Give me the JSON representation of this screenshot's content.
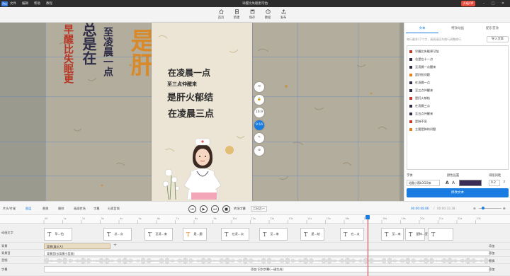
{
  "app": {
    "logo": "Pro",
    "menu": [
      "文件",
      "编辑",
      "帮助",
      "教程"
    ],
    "title": "早醒比失眠更可怕",
    "vip": "升级VIP",
    "colors": {
      "accent": "#1a7be0",
      "vip": "#e84b3c"
    }
  },
  "toolbar": [
    {
      "label": "首页",
      "icon": "home-icon"
    },
    {
      "label": "新建",
      "icon": "new-file-icon"
    },
    {
      "label": "保存",
      "icon": "save-icon"
    },
    {
      "label": "教程",
      "icon": "help-icon"
    },
    {
      "label": "发布",
      "icon": "export-icon"
    }
  ],
  "canvas": {
    "bg_left": [
      "早醒比失眠更",
      "总是在",
      "至凌晨一点",
      "是肝"
    ],
    "bg_right": [
      "是肝火郁结"
    ],
    "captions": [
      "在凌晨一点",
      "至三点仲醒来",
      "是肝火郁结",
      "在凌晨三点"
    ],
    "side_buttons": [
      "⟲",
      "🔒",
      "16:9",
      "9:16",
      "✎",
      "⊚"
    ]
  },
  "panel": {
    "tabs": [
      "文本",
      "特效动画",
      "配乐音效"
    ],
    "hint": "每行最多17个字，请直接回车换行调整换行",
    "import_label": "导入文本",
    "items": [
      {
        "text": "早醒比失眠更可怕",
        "color": "#c0392b"
      },
      {
        "text": "总是在十一点",
        "color": "#2c2c4a"
      },
      {
        "text": "至凌晨一点醒来",
        "color": "#2c2c4a"
      },
      {
        "text": "是肝胆问题",
        "color": "#e67e22"
      },
      {
        "text": "在凌晨一点",
        "color": "#2c2c4a"
      },
      {
        "text": "至三点仲醒来",
        "color": "#2c2c4a"
      },
      {
        "text": "是肝火郁结",
        "color": "#c0392b"
      },
      {
        "text": "在凌晨三点",
        "color": "#2c2c4a"
      },
      {
        "text": "至五点仲醒来",
        "color": "#2c2c4a"
      },
      {
        "text": "是肺不宣",
        "color": "#c0392b"
      },
      {
        "text": "主要是肺的问题",
        "color": "#e67e22"
      }
    ],
    "font_label": "字体",
    "font_value": "站酷小薇LOGO体",
    "color_label": "颜色设置",
    "size_label": "排版间距",
    "size_value": "0.2",
    "modify_label": "修改文本"
  },
  "timeline": {
    "left_tools": [
      "片头/片尾",
      "图层",
      "替换",
      "删除",
      "画面转场",
      "字幕",
      "分离音频"
    ],
    "ratio_label": "转场字幕",
    "ratio_value": "二分之一",
    "time_current": "00:00:08.86",
    "time_total": "00:00:33.38",
    "ruler": [
      "00",
      "1s",
      "2s",
      "3s",
      "4s",
      "5s",
      "6s",
      "7s",
      "8s",
      "9s",
      "10s",
      "11s",
      "12s",
      "13s",
      "14s",
      "15s",
      "16s",
      "17s",
      "18s",
      "19s",
      "20s",
      "21s",
      "22s",
      "23s"
    ],
    "playhead_fraction": 0.38,
    "tracks": [
      "动画文字",
      "背景",
      "背景音",
      "音频",
      "字幕"
    ],
    "clips": [
      "早...怕",
      "总...点",
      "至凌...来",
      "是...题",
      "在凌...点",
      "至...来",
      "是...结",
      "在...点",
      "至...来",
      "是肺...宣",
      ""
    ],
    "bg_clip": "背景(展示大)",
    "music_clip": "背景音(长背景小音频)",
    "subtitle_clip": "添加·识别字幕(一键生成)",
    "add_labels": [
      "添加",
      "添加",
      "替换",
      "添加"
    ]
  }
}
